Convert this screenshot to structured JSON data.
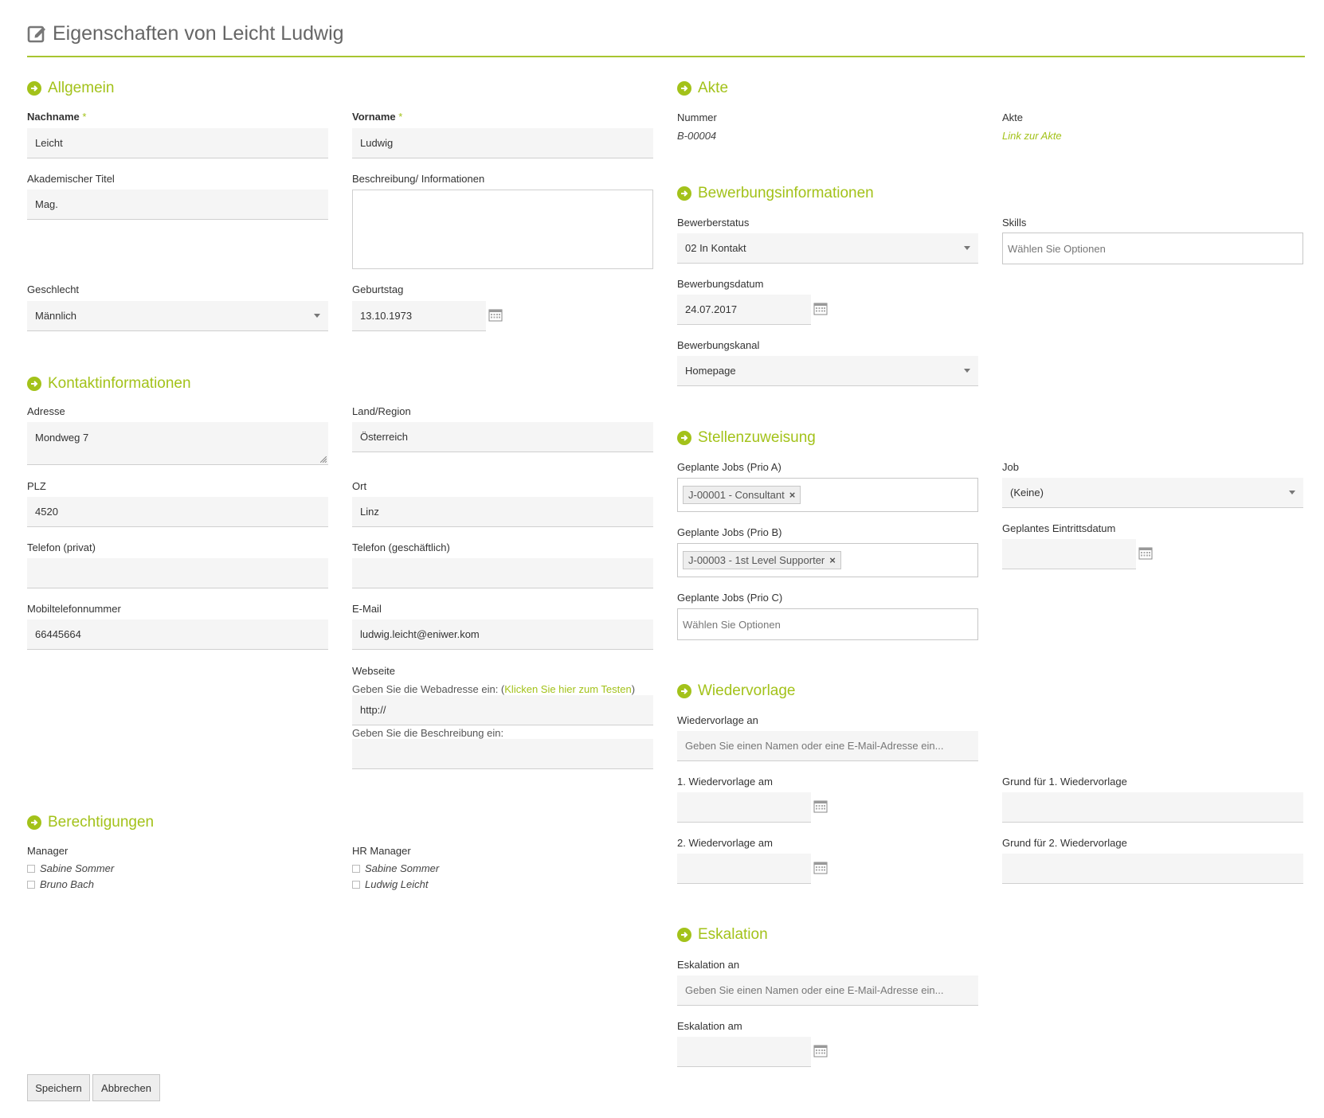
{
  "page_title": "Eigenschaften von Leicht Ludwig",
  "colors": {
    "accent": "#a3c21a",
    "field_bg": "#f5f5f5",
    "border": "#cfcfcf"
  },
  "sections": {
    "allgemein": "Allgemein",
    "kontakt": "Kontaktinformationen",
    "berechtigungen": "Berechtigungen",
    "akte": "Akte",
    "bewerbung": "Bewerbungsinformationen",
    "stellen": "Stellenzuweisung",
    "wiedervorlage": "Wiedervorlage",
    "eskalation": "Eskalation"
  },
  "required_mark": "*",
  "allgemein": {
    "nachname_label": "Nachname",
    "nachname_value": "Leicht",
    "vorname_label": "Vorname",
    "vorname_value": "Ludwig",
    "titel_label": "Akademischer Titel",
    "titel_value": "Mag.",
    "beschreibung_label": "Beschreibung/ Informationen",
    "beschreibung_value": "",
    "geschlecht_label": "Geschlecht",
    "geschlecht_value": "Männlich",
    "geburtstag_label": "Geburtstag",
    "geburtstag_value": "13.10.1973"
  },
  "kontakt": {
    "adresse_label": "Adresse",
    "adresse_value": "Mondweg 7",
    "land_label": "Land/Region",
    "land_value": "Österreich",
    "plz_label": "PLZ",
    "plz_value": "4520",
    "ort_label": "Ort",
    "ort_value": "Linz",
    "tel_privat_label": "Telefon (privat)",
    "tel_privat_value": "",
    "tel_gesch_label": "Telefon (geschäftlich)",
    "tel_gesch_value": "",
    "mobil_label": "Mobiltelefonnummer",
    "mobil_value": "66445664",
    "email_label": "E-Mail",
    "email_value": "ludwig.leicht@eniwer.kom",
    "webseite_label": "Webseite",
    "webseite_hint_prefix": "Geben Sie die Webadresse ein: (",
    "webseite_hint_link": "Klicken Sie hier zum Testen",
    "webseite_hint_suffix": ")",
    "webseite_value": "http://",
    "webseite_desc_hint": "Geben Sie die Beschreibung ein:",
    "webseite_desc_value": ""
  },
  "berechtigungen": {
    "manager_label": "Manager",
    "manager_options": [
      "Sabine Sommer",
      "Bruno Bach"
    ],
    "hr_label": "HR Manager",
    "hr_options": [
      "Sabine Sommer",
      "Ludwig Leicht"
    ]
  },
  "akte": {
    "nummer_label": "Nummer",
    "nummer_value": "B-00004",
    "akte_label": "Akte",
    "akte_link": "Link zur Akte"
  },
  "bewerbung": {
    "status_label": "Bewerberstatus",
    "status_value": "02 In Kontakt",
    "skills_label": "Skills",
    "skills_placeholder": "Wählen Sie Optionen",
    "datum_label": "Bewerbungsdatum",
    "datum_value": "24.07.2017",
    "kanal_label": "Bewerbungskanal",
    "kanal_value": "Homepage"
  },
  "stellen": {
    "prio_a_label": "Geplante Jobs (Prio A)",
    "prio_a_tag": "J-00001 - Consultant",
    "job_label": "Job",
    "job_value": "(Keine)",
    "prio_b_label": "Geplante Jobs (Prio B)",
    "prio_b_tag": "J-00003 - 1st Level Supporter",
    "eintritt_label": "Geplantes Eintrittsdatum",
    "eintritt_value": "",
    "prio_c_label": "Geplante Jobs (Prio C)",
    "prio_c_placeholder": "Wählen Sie Optionen",
    "tag_remove": "×"
  },
  "wiedervorlage": {
    "an_label": "Wiedervorlage an",
    "an_placeholder": "Geben Sie einen Namen oder eine E-Mail-Adresse ein...",
    "wv1_label": "1. Wiedervorlage am",
    "grund1_label": "Grund für 1. Wiedervorlage",
    "wv2_label": "2. Wiedervorlage am",
    "grund2_label": "Grund für 2. Wiedervorlage"
  },
  "eskalation": {
    "an_label": "Eskalation an",
    "an_placeholder": "Geben Sie einen Namen oder eine E-Mail-Adresse ein...",
    "am_label": "Eskalation am"
  },
  "buttons": {
    "save": "Speichern",
    "cancel": "Abbrechen"
  }
}
